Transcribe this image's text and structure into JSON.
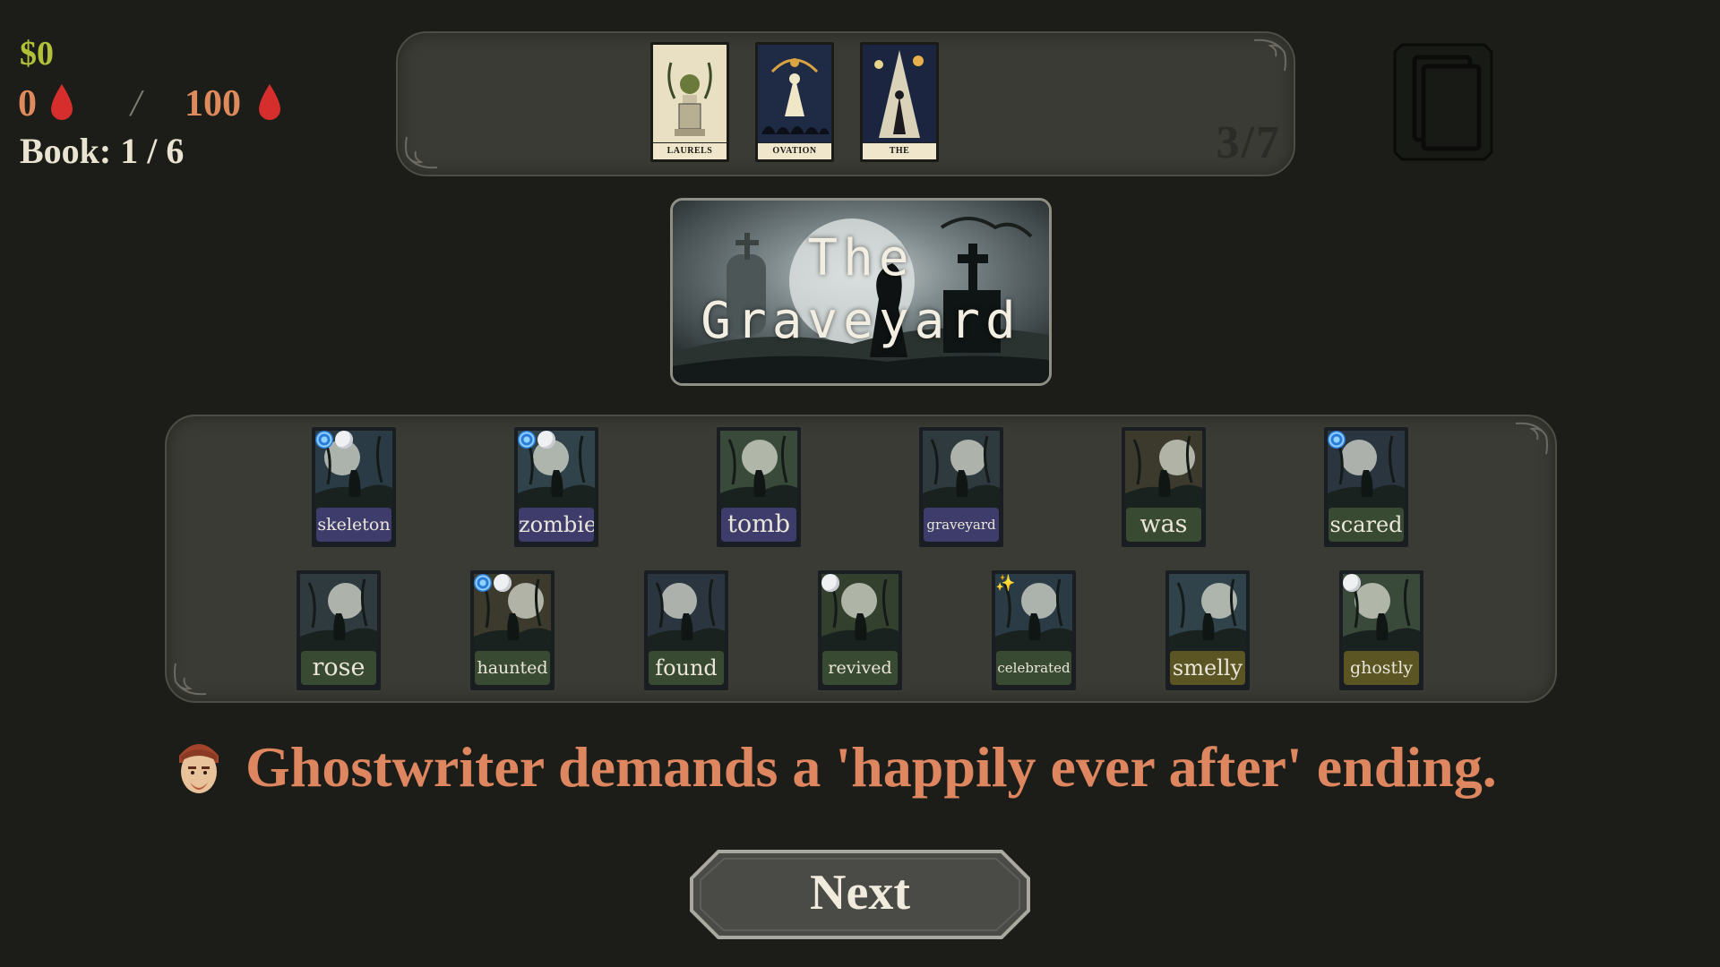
{
  "colors": {
    "money": "#b2c13a",
    "blood": "#df8a5c",
    "drop": "#d62d2d",
    "message": "#dd8660",
    "panel": "#3b3b35",
    "background": "#1c1d18"
  },
  "hud": {
    "money": "$0",
    "blood_current": "0",
    "blood_separator": "/",
    "blood_max": "100",
    "book_label": "Book:",
    "book_value": "1 / 6"
  },
  "top_tray": {
    "count": "3/7",
    "cards": [
      {
        "label": "LAURELS",
        "icon": "laurel-bust-icon"
      },
      {
        "label": "OVATION",
        "icon": "ovation-crowd-icon"
      },
      {
        "label": "THE SPOTLIGHT",
        "icon": "spotlight-icon"
      }
    ]
  },
  "deck": {
    "icon": "card-deck-icon"
  },
  "location": {
    "title": "The\nGraveyard"
  },
  "words": {
    "row1": [
      {
        "text": "skeleton",
        "color": "purple",
        "badges": [
          "spiral",
          "moon"
        ]
      },
      {
        "text": "zombie",
        "color": "purple",
        "badges": [
          "spiral",
          "moon"
        ]
      },
      {
        "text": "tomb",
        "color": "purple",
        "badges": []
      },
      {
        "text": "graveyard",
        "color": "purple",
        "badges": []
      },
      {
        "text": "was",
        "color": "green",
        "badges": []
      },
      {
        "text": "scared",
        "color": "green",
        "badges": [
          "spiral"
        ]
      }
    ],
    "row2": [
      {
        "text": "rose",
        "color": "green",
        "badges": []
      },
      {
        "text": "haunted",
        "color": "green",
        "badges": [
          "spiral",
          "moon"
        ]
      },
      {
        "text": "found",
        "color": "green",
        "badges": []
      },
      {
        "text": "revived",
        "color": "green",
        "badges": [
          "moon"
        ]
      },
      {
        "text": "celebrated",
        "color": "green",
        "badges": [
          "spark"
        ]
      },
      {
        "text": "smelly",
        "color": "olive",
        "badges": []
      },
      {
        "text": "ghostly",
        "color": "olive",
        "badges": [
          "moon"
        ]
      }
    ]
  },
  "message": {
    "text": "Ghostwriter demands a 'happily ever after' ending.",
    "avatar": "ghostwriter-avatar-icon"
  },
  "next_button": {
    "label": "Next"
  }
}
